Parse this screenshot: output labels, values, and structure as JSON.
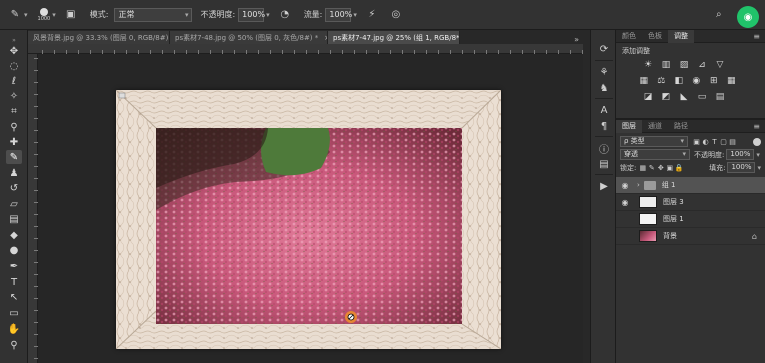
{
  "options_bar": {
    "brush_size": "1000",
    "mode_label": "模式:",
    "mode_value": "正常",
    "opacity_label": "不透明度:",
    "opacity_value": "100%",
    "flow_label": "流量:",
    "flow_value": "100%"
  },
  "tabs": [
    {
      "label": "风景背景.jpg @ 33.3% (图层 0, RGB/8#) *",
      "active": false
    },
    {
      "label": "ps素材7-48.jpg @ 50% (图层 0, 灰色/8#) *",
      "active": false
    },
    {
      "label": "ps素材7-47.jpg @ 25% (组 1, RGB/8*) *",
      "active": true
    }
  ],
  "close_glyph": "×",
  "tabs_more": "»",
  "panels": {
    "top_tabs": [
      "颜色",
      "色板",
      "调整"
    ],
    "adjustments_title": "添加调整",
    "adjust_row1": [
      "☀",
      "▥",
      "▨",
      "⊿",
      "▽"
    ],
    "adjust_row2": [
      "▦",
      "⚖",
      "◧",
      "◉",
      "⊞",
      "▦"
    ],
    "adjust_row3": [
      "◪",
      "◩",
      "◣",
      "▭",
      "▤"
    ],
    "layer_tabs": [
      "图层",
      "通道",
      "路径"
    ],
    "filter_label": "ρ 类型",
    "blend_mode": "穿透",
    "opacity_label": "不透明度:",
    "opacity_value": "100%",
    "lock_label": "锁定:",
    "fill_label": "填充:",
    "fill_value": "100%"
  },
  "layers": [
    {
      "name": "组 1",
      "visible": true,
      "selected": true,
      "type": "group",
      "thumb_color": "#7d7d7d"
    },
    {
      "name": "图层 3",
      "visible": true,
      "selected": false,
      "type": "layer",
      "thumb_color": "#ededed"
    },
    {
      "name": "图层 1",
      "visible": false,
      "selected": false,
      "type": "layer",
      "thumb_color": "#f4f4f4"
    },
    {
      "name": "背景",
      "visible": false,
      "selected": false,
      "type": "background",
      "thumb_color": "#b4506e"
    }
  ],
  "colors": {
    "wifi_badge": "#20c36a",
    "selected_layer": "#535353",
    "panel_bg": "#323232",
    "canvas_bg": "#262626"
  }
}
